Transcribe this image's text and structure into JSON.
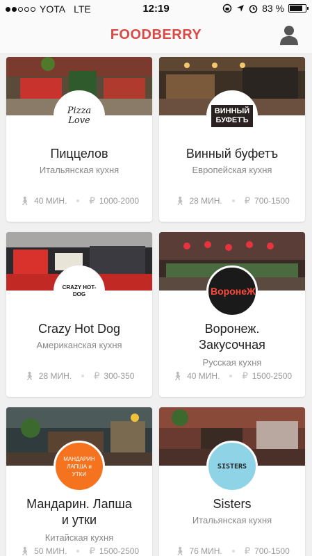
{
  "status": {
    "carrier": "YOTA",
    "network": "LTE",
    "time": "12:19",
    "battery_percent": "83 %",
    "battery_level": 0.83
  },
  "app": {
    "title": "FOODBERRY",
    "accent": "#d94a46"
  },
  "restaurants": [
    {
      "name": "Пиццелов",
      "cuisine": "Итальянская кухня",
      "time": "40 МИН.",
      "price": "1000-2000",
      "logo_text": "Pizza Love",
      "logo_bg": "#ffffff"
    },
    {
      "name": "Винный буфетъ",
      "cuisine": "Европейская кухня",
      "time": "28 МИН.",
      "price": "700-1500",
      "logo_text": "ВИННЫЙ БУФЕТЪ",
      "logo_bg": "#ffffff"
    },
    {
      "name": "Crazy Hot Dog",
      "cuisine": "Американская кухня",
      "time": "28 МИН.",
      "price": "300-350",
      "logo_text": "CRAZY HOT-DOG",
      "logo_bg": "#ffffff"
    },
    {
      "name": "Воронеж. Закусочная",
      "cuisine": "Русская кухня",
      "time": "40 МИН.",
      "price": "1500-2500",
      "logo_text": "ВоронеЖ",
      "logo_bg": "#1a1a1a"
    },
    {
      "name": "Мандарин. Лапша и утки",
      "cuisine": "Китайская кухня",
      "time": "50 МИН.",
      "price": "1500-2500",
      "logo_text": "МАНДАРИН ЛАПША и УТКИ",
      "logo_bg": "#f5731f"
    },
    {
      "name": "Sisters",
      "cuisine": "Итальянская кухня",
      "time": "76 МИН.",
      "price": "700-1500",
      "logo_text": "SISTERS",
      "logo_bg": "#8ed3e6"
    }
  ]
}
